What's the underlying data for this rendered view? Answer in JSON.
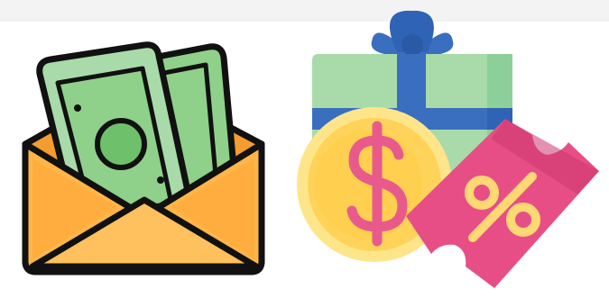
{
  "illustrations": [
    {
      "name": "money-envelope-icon",
      "description_icon": "envelope-with-cash-icon"
    },
    {
      "name": "gift-coin-discount-icon",
      "description_icon": "gift-box-coin-coupon-icon"
    }
  ],
  "colors": {
    "outline": "#111111",
    "envelope_fill": "#ffb648",
    "envelope_flap": "#ffc05e",
    "envelope_inner": "#f39c2f",
    "cash_green": "#8fd18a",
    "cash_green_dark": "#5fb85d",
    "gift_green": "#a8dba9",
    "gift_ribbon": "#3a6fbf",
    "gift_bow": "#2f63b5",
    "coin_yellow": "#ffd35a",
    "coin_edge": "#ffe58a",
    "dollar_pink": "#e85a8c",
    "coupon_pink": "#e84e86",
    "coupon_dark": "#cc3670",
    "percent_yellow": "#ffd873",
    "topbar": "#f3f3f4"
  },
  "symbols": {
    "coin_symbol": "$",
    "coupon_symbol": "%"
  }
}
